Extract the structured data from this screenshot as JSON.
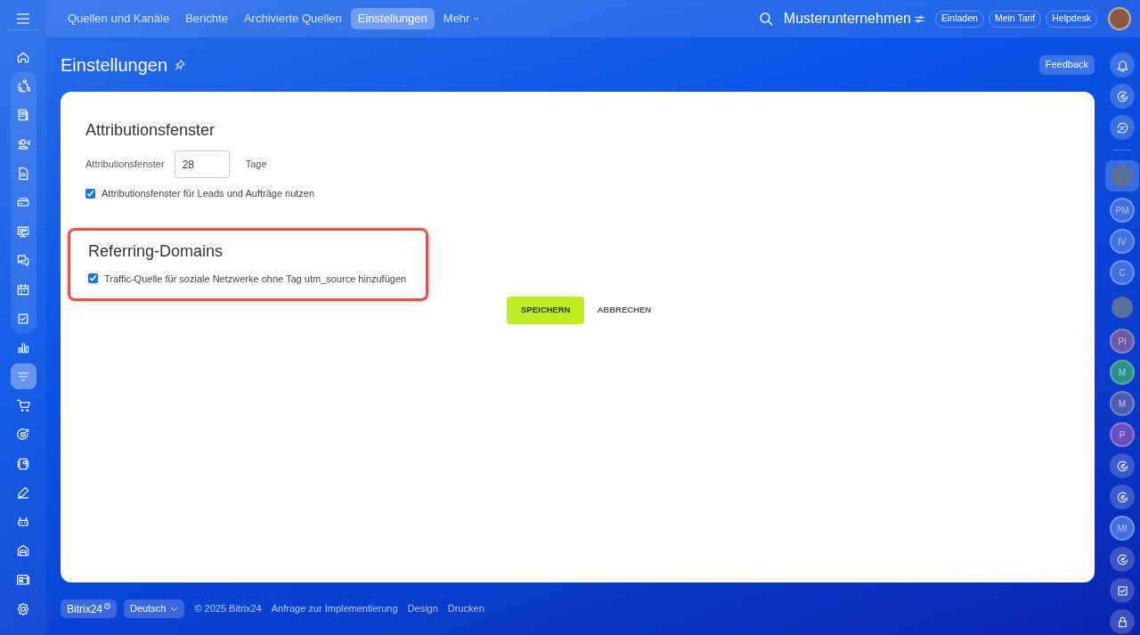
{
  "top_nav": {
    "tabs": [
      {
        "label": "Quellen und Kanäle",
        "selected": false
      },
      {
        "label": "Berichte",
        "selected": false
      },
      {
        "label": "Archivierte Quellen",
        "selected": false
      },
      {
        "label": "Einstellungen",
        "selected": true
      },
      {
        "label": "Mehr",
        "selected": false
      }
    ],
    "company": "Musterunternehmen",
    "buttons": [
      "Einladen",
      "Mein Tarif",
      "Helpdesk"
    ]
  },
  "left_sidebar": [
    {
      "kind": "home",
      "selected": false,
      "grouped": false
    },
    {
      "kind": "circle",
      "selected": false,
      "grouped": true
    },
    {
      "kind": "news",
      "selected": false,
      "grouped": true
    },
    {
      "kind": "people",
      "selected": false,
      "grouped": true
    },
    {
      "kind": "doc",
      "selected": false,
      "grouped": true
    },
    {
      "kind": "drive",
      "selected": false,
      "grouped": true
    },
    {
      "kind": "board",
      "selected": false,
      "grouped": true
    },
    {
      "kind": "chat",
      "selected": false,
      "grouped": true
    },
    {
      "kind": "calendar",
      "selected": false,
      "grouped": true
    },
    {
      "kind": "task",
      "selected": false,
      "grouped": true
    },
    {
      "kind": "chart",
      "selected": false,
      "grouped": false
    },
    {
      "kind": "funnel",
      "selected": true,
      "grouped": false
    },
    {
      "kind": "cart",
      "selected": false,
      "grouped": false
    },
    {
      "kind": "target",
      "selected": false,
      "grouped": false
    },
    {
      "kind": "device",
      "selected": false,
      "grouped": false
    },
    {
      "kind": "pen",
      "selected": false,
      "grouped": false
    },
    {
      "kind": "robot",
      "selected": false,
      "grouped": false
    },
    {
      "kind": "warehouse",
      "selected": false,
      "grouped": false
    },
    {
      "kind": "card",
      "selected": false,
      "grouped": false
    },
    {
      "kind": "settings",
      "selected": false,
      "grouped": false
    }
  ],
  "page": {
    "title": "Einstellungen",
    "feedback": "Feedback"
  },
  "sections": [
    {
      "title": "Attributionsfenster",
      "highlighted": false,
      "field": {
        "label": "Attributionsfenster",
        "value": "28",
        "unit": "Tage"
      },
      "checkbox": {
        "label": "Attributionsfenster für Leads und Aufträge nutzen",
        "checked": true
      }
    },
    {
      "title": "Referring-Domains",
      "highlighted": true,
      "checkbox": {
        "label": "Traffic-Quelle für soziale Netzwerke ohne Tag utm_source hinzufügen",
        "checked": true
      }
    }
  ],
  "actions": [
    "SPEICHERN",
    "ABBRECHEN"
  ],
  "right_sidebar": [
    {
      "kind": "bell"
    },
    {
      "kind": "copilot"
    },
    {
      "kind": "search-chat"
    },
    {
      "kind": "divider"
    },
    {
      "kind": "photo",
      "selected": true
    },
    {
      "kind": "initials",
      "text": "PM",
      "color": "#3f6fe0"
    },
    {
      "kind": "initials",
      "text": "IV",
      "color": "#3f6fe0"
    },
    {
      "kind": "initials",
      "text": "C",
      "color": "#3f6fe0"
    },
    {
      "kind": "photo",
      "selected": false
    },
    {
      "kind": "initials",
      "text": "PI",
      "color": "#6a5aa8"
    },
    {
      "kind": "initials",
      "text": "M",
      "color": "#2b8f8a"
    },
    {
      "kind": "initials",
      "text": "M",
      "color": "#4d5fb0"
    },
    {
      "kind": "initials",
      "text": "P",
      "color": "#6a4fc0"
    },
    {
      "kind": "copilot"
    },
    {
      "kind": "copilot"
    },
    {
      "kind": "initials",
      "text": "MI",
      "color": "#3f6fe0"
    },
    {
      "kind": "copilot"
    },
    {
      "kind": "task"
    },
    {
      "kind": "lock"
    }
  ],
  "footer": {
    "brand": "Bitrix24",
    "language": "Deutsch",
    "links": [
      "© 2025 Bitrix24",
      "Anfrage zur Implementierung",
      "Design",
      "Drucken"
    ]
  }
}
